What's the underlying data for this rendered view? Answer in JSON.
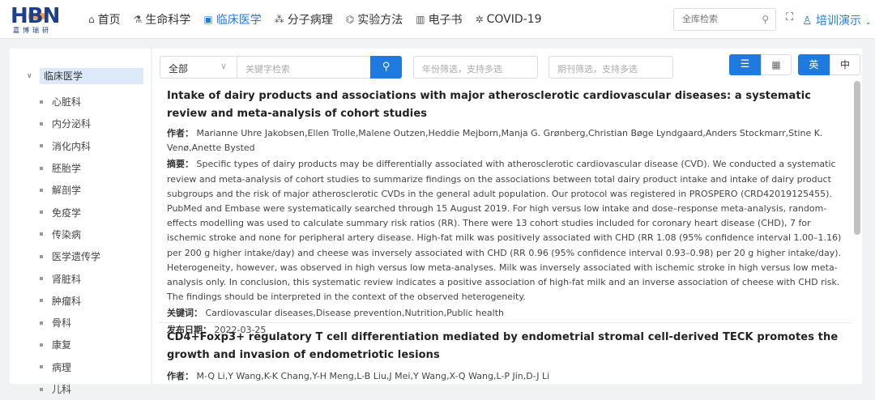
{
  "brand": {
    "logo_text": "HBN",
    "logo_sub": "嘉博瑞研"
  },
  "nav": [
    {
      "icon": "home-icon",
      "glyph": "⌂",
      "label": "首页",
      "active": false
    },
    {
      "icon": "flask-icon",
      "glyph": "⚗",
      "label": "生命科学",
      "active": false
    },
    {
      "icon": "clinic-icon",
      "glyph": "▣",
      "label": "临床医学",
      "active": true
    },
    {
      "icon": "molecule-icon",
      "glyph": "⁂",
      "label": "分子病理",
      "active": false
    },
    {
      "icon": "test-tube-icon",
      "glyph": "⌬",
      "label": "实验方法",
      "active": false
    },
    {
      "icon": "book-icon",
      "glyph": "▥",
      "label": "电子书",
      "active": false
    },
    {
      "icon": "virus-icon",
      "glyph": "✲",
      "label": "COVID-19",
      "active": false
    }
  ],
  "global_search": {
    "placeholder": "全库检索"
  },
  "user": {
    "name": "培训演示"
  },
  "sidebar": {
    "root": "临床医学",
    "items": [
      "心脏科",
      "内分泌科",
      "消化内科",
      "胚胎学",
      "解剖学",
      "免疫学",
      "传染病",
      "医学遗传学",
      "肾脏科",
      "肿瘤科",
      "骨科",
      "康复",
      "病理",
      "儿科"
    ]
  },
  "toolbar": {
    "type_select": "全部",
    "keyword_placeholder": "关键字检索",
    "year_placeholder": "年份筛选，支持多选",
    "journal_placeholder": "期刊筛选，支持多选",
    "lang_en": "英",
    "lang_zh": "中"
  },
  "labels": {
    "author": "作者：",
    "abstract": "摘要：",
    "keywords": "关键词：",
    "date": "发布日期："
  },
  "articles": [
    {
      "title": "Intake of dairy products and associations with major atherosclerotic cardiovascular diseases: a systematic review and meta-analysis of cohort studies",
      "authors": "Marianne Uhre Jakobsen,Ellen Trolle,Malene Outzen,Heddie Mejborn,Manja G. Grønberg,Christian Bøge Lyndgaard,Anders Stockmarr,Stine K. Venø,Anette Bysted",
      "abstract": "Specific types of dairy products may be differentially associated with atherosclerotic cardiovascular disease (CVD). We conducted a systematic review and meta-analysis of cohort studies to summarize findings on the associations between total dairy product intake and intake of dairy product subgroups and the risk of major atherosclerotic CVDs in the general adult population. Our protocol was registered in PROSPERO (CRD42019125455). PubMed and Embase were systematically searched through 15 August 2019. For high versus low intake and dose–response meta-analysis, random-effects modelling was used to calculate summary risk ratios (RR). There were 13 cohort studies included for coronary heart disease (CHD), 7 for ischemic stroke and none for peripheral artery disease. High-fat milk was positively associated with CHD (RR 1.08 (95% confidence interval 1.00–1.16) per 200 g higher intake/day) and cheese was inversely associated with CHD (RR 0.96 (95% confidence interval 0.93–0.98) per 20 g higher intake/day). Heterogeneity, however, was observed in high versus low meta-analyses. Milk was inversely associated with ischemic stroke in high versus low meta-analysis only. In conclusion, this systematic review indicates a positive association of high-fat milk and an inverse association of cheese with CHD risk. The findings should be interpreted in the context of the observed heterogeneity.",
      "keywords": "Cardiovascular diseases,Disease prevention,Nutrition,Public health",
      "date": "2022-03-25"
    },
    {
      "title": "CD4+Foxp3+ regulatory T cell differentiation mediated by endometrial stromal cell-derived TECK promotes the growth and invasion of endometriotic lesions",
      "authors": "M-Q Li,Y Wang,K-K Chang,Y-H Meng,L-B Liu,J Mei,Y Wang,X-Q Wang,L-P Jin,D-J Li"
    }
  ]
}
